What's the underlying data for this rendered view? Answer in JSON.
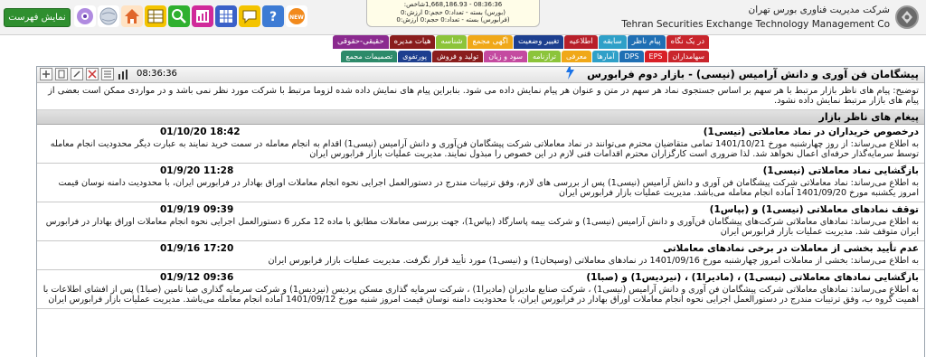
{
  "header": {
    "show_list_label": "نمایش فهرست",
    "icons": [
      {
        "name": "network-icon",
        "color": "#b08be0"
      },
      {
        "name": "globe-icon",
        "color": "#b9c6d6"
      },
      {
        "name": "home-icon",
        "color": "#ffd9b0"
      },
      {
        "name": "table-icon",
        "color": "#f4c400"
      },
      {
        "name": "search-icon",
        "color": "#2fb02f"
      },
      {
        "name": "chart-icon",
        "color": "#d02a9a"
      },
      {
        "name": "grid-icon",
        "color": "#3a60c8"
      },
      {
        "name": "message-icon",
        "color": "#f4c400"
      },
      {
        "name": "help-icon",
        "color": "#3d7bd4"
      },
      {
        "name": "new-badge-icon",
        "color": "#f28a1c"
      }
    ],
    "market_lines": [
      "08:36:36 - 1,668,186.93شاخص:",
      "(بورس) بسته - تعداد:0 حجم:0 ارزش:0",
      "(فرابورس) بسته - تعداد:0 حجم:0 ارزش:0"
    ],
    "org_fa": "شرکت مدیریت فناوری بورس تهران",
    "org_en": "Tehran Securities Exchange Technology Management Co"
  },
  "tabs_row1": [
    {
      "label": "در یک نگاه",
      "color": "#c9252c"
    },
    {
      "label": "پیام ناظر",
      "color": "#1f6fb4"
    },
    {
      "label": "سابقه",
      "color": "#2fa0c8"
    },
    {
      "label": "اطلاعیه",
      "color": "#b8202a"
    },
    {
      "label": "تغییر وضعیت",
      "color": "#1d3f8f"
    },
    {
      "label": "اگهی مجمع",
      "color": "#f0a818"
    },
    {
      "label": "شناسه",
      "color": "#8cc43a"
    },
    {
      "label": "هیات مدیره",
      "color": "#8a1d1d"
    },
    {
      "label": "حقیقی-حقوقی",
      "color": "#8b2a8f"
    }
  ],
  "tabs_row2": [
    {
      "label": "سهامداران",
      "color": "#c9252c"
    },
    {
      "label": "EPS",
      "color": "#d81f26"
    },
    {
      "label": "DPS",
      "color": "#1f6fb4"
    },
    {
      "label": "آمارها",
      "color": "#2fa0c8"
    },
    {
      "label": "معرفی",
      "color": "#f0a818"
    },
    {
      "label": "ترازنامه",
      "color": "#8cc43a"
    },
    {
      "label": "سود و زیان",
      "color": "#c44aa0"
    },
    {
      "label": "تولید و فروش",
      "color": "#8a1d1d"
    },
    {
      "label": "پورتفوی",
      "color": "#1d3f8f"
    },
    {
      "label": "تصمیمات مجمع",
      "color": "#2d8a6a"
    }
  ],
  "panel": {
    "title": "پیشگامان فن آوری و دانش آرامیس (نیسی) - بازار دوم فرابورس",
    "clock": "08:36:36",
    "tools": [
      "add-icon",
      "document-icon",
      "edit-icon",
      "tools-icon",
      "list-icon",
      "bar-chart-icon"
    ],
    "description": "توضیح: پیام های ناظر بازار مرتبط با هر سهم بر اساس جستجوی نماد هر سهم در متن و عنوان هر پیام نمایش داده می شود. بنابراین پیام های نمایش داده شده لزوما مرتبط با شرکت مورد نظر نمی باشد و در مواردی ممکن است بعضی از پیام های بازار مرتبط نمایش داده نشود.",
    "section_title": "پیغام های ناظر بازار",
    "messages": [
      {
        "title": "درخصوص خریداران در نماد معاملاتی (نیسی1)",
        "date": "01/10/20 18:42",
        "body": "به اطلاع می‌رساند: از روز چهارشنبه مورخ 1401/10/21 تمامی متقاضیان محترم می‌توانند در نماد معاملاتی شرکت پیشگامان فن‌آوری و دانش آرامیس (نیسی1) اقدام به انجام معامله در سمت خرید نمایند به عبارت دیگر محدودیت انجام معامله توسط سرمایه‌گذار حرفه‌ای اعمال نخواهد شد. لذا ضروری است کارگزاران محترم اقدامات فنی لازم در این خصوص را مبذول نمایند. مدیریت عملیات بازار فرابورس ایران"
      },
      {
        "title": "بازگشایی نماد معاملاتی (نیسی1)",
        "date": "01/9/20 11:28",
        "body": "به اطلاع می‌رساند: نماد معاملاتی شرکت پیشگامان فن آوری و دانش آرامیس (نیسی1) پس از بررسی های لازم، وفق ترتیبات مندرج در دستورالعمل اجرایی نحوه انجام معاملات اوراق بهادار در فرابورس ایران، با محدودیت دامنه نوسان قیمت امروز یکشنبه مورخ 1401/09/20 آماده انجام معامله می‌باشد. مدیریت عملیات بازار فرابورس ایران"
      },
      {
        "title": "توقف نمادهای معاملاتی (نیسی1) و (بپاس1)",
        "date": "01/9/19 09:39",
        "body": "به اطلاع می‌رساند: نمادهای معاملاتی شرکت‌های پیشگامان فن‌آوری و دانش آرامیس (نیسی1) و شرکت بیمه پاسارگاد (بپاس1)، جهت بررسی معاملات مطابق با ماده 12 مکرر 6 دستورالعمل اجرایی نحوه انجام معاملات اوراق بهادار در فرابورس ایران متوقف شد. مدیریت عملیات بازار فرابورس ایران"
      },
      {
        "title": "عدم تأیید بخشی از معاملات در برخی نمادهای معاملاتی",
        "date": "01/9/16 17:20",
        "body": "به اطلاع می‌رساند: بخشی از معاملات امروز چهارشنبه مورخ 1401/09/16 در نمادهای معاملاتی (وسپحان1) و (نیسی1) مورد تأیید قرار نگرفت. مدیریت عملیات بازار فرابورس ایران"
      },
      {
        "title": "بازگشایی نمادهای معاملاتی (نیسی1) ، (مادیرا1) ، (نیردیس1) و (صبا1)",
        "date": "01/9/12 09:36",
        "body": "به اطلاع می‌رساند: نمادهای معاملاتی شرکت پیشگامان فن آوری و دانش آرامیس (نیسی1) ، شرکت صنایع مادیران (مادیرا1) ، شرکت سرمایه گذاری مسکن پردیس (نیردیس1) و شرکت سرمایه گذاری صبا تامین (صبا1) پس از افشای اطلاعات با اهمیت گروه ب، وفق ترتیبات مندرج در دستورالعمل اجرایی نحوه انجام معاملات اوراق بهادار در فرابورس ایران، با محدودیت دامنه نوسان قیمت امروز شنبه مورخ 1401/09/12 آماده انجام معامله می‌باشد. مدیریت عملیات بازار فرابورس ایران"
      }
    ]
  }
}
